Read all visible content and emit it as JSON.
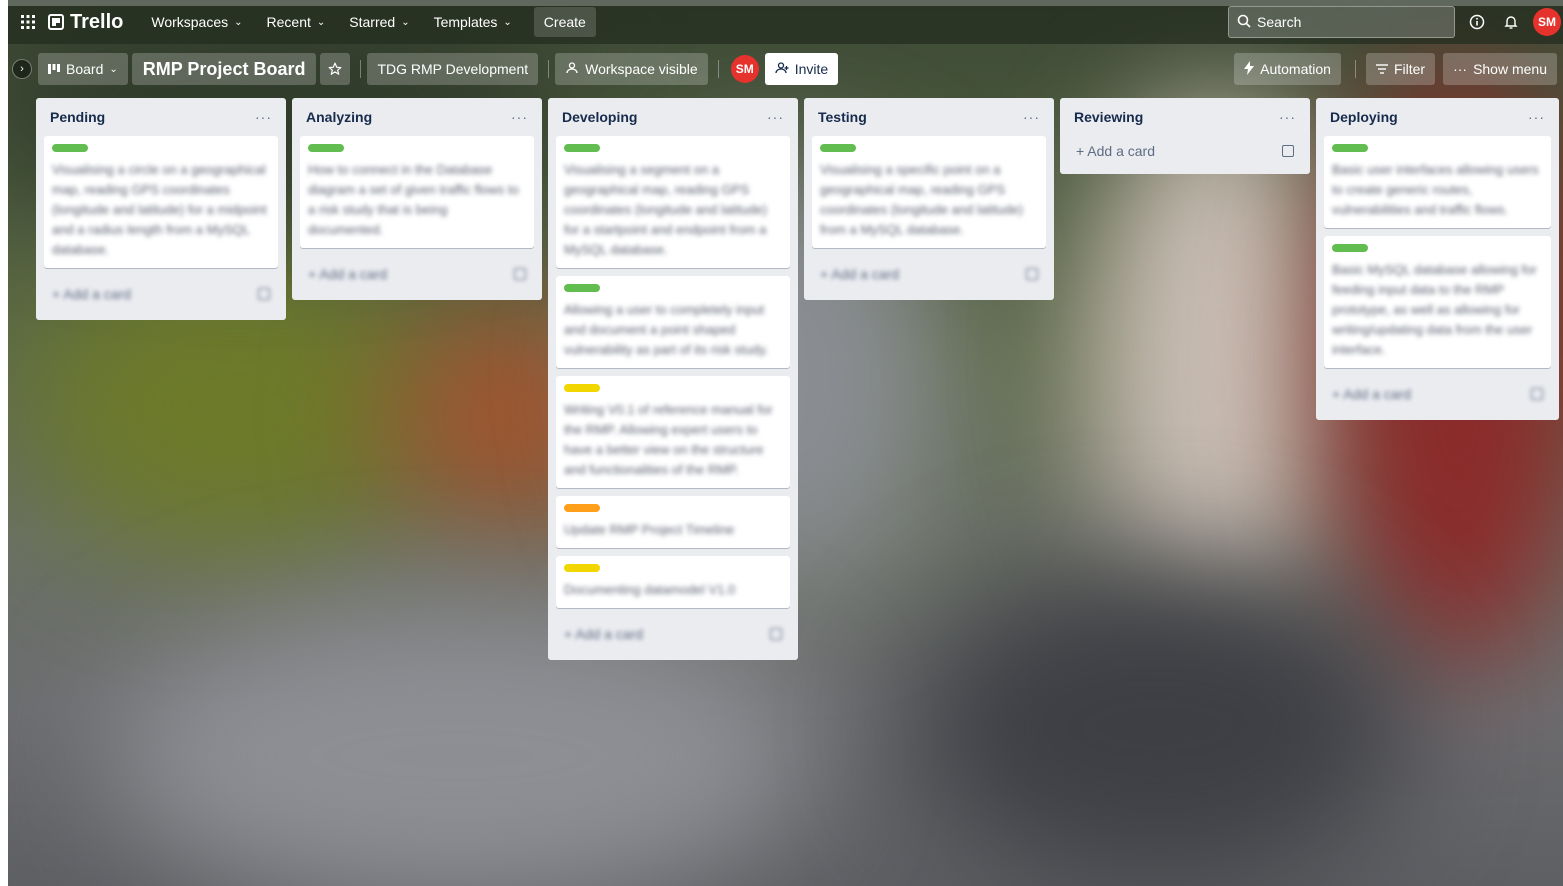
{
  "topbar": {
    "logo": "Trello",
    "nav": [
      {
        "label": "Workspaces"
      },
      {
        "label": "Recent"
      },
      {
        "label": "Starred"
      },
      {
        "label": "Templates"
      }
    ],
    "create": "Create",
    "search_placeholder": "Search",
    "avatar": "SM"
  },
  "boardbar": {
    "view": "Board",
    "title": "RMP Project Board",
    "workspace": "TDG RMP Development",
    "visibility": "Workspace visible",
    "member_avatar": "SM",
    "invite": "Invite",
    "automation": "Automation",
    "filter": "Filter",
    "show_menu": "Show menu"
  },
  "add_card_label": "Add a card",
  "colors": {
    "green": "#61bd4f",
    "yellow": "#f2d600",
    "orange": "#ff9f1a",
    "avatar_red": "#e5322d"
  },
  "lists": [
    {
      "title": "Pending",
      "cards": [
        {
          "label": "green",
          "text": "Visualising a circle on a geographical map, reading GPS coordinates (longitude and latitude) for a midpoint and a radius length from a MySQL database."
        }
      ]
    },
    {
      "title": "Analyzing",
      "cards": [
        {
          "label": "green",
          "text": "How to connect in the Database diagram a set of given traffic flows to a risk study that is being documented."
        }
      ]
    },
    {
      "title": "Developing",
      "cards": [
        {
          "label": "green",
          "text": "Visualising a segment on a geographical map, reading GPS coordinates (longitude and latitude) for a startpoint and endpoint from a MySQL database."
        },
        {
          "label": "green",
          "text": "Allowing a user to completely input and document a point shaped vulnerability as part of its risk study."
        },
        {
          "label": "yellow",
          "text": "Writing V0.1 of reference manual for the RMP. Allowing expert users to have a better view on the structure and functionalities of the RMP."
        },
        {
          "label": "orange",
          "text": "Update RMP Project Timeline"
        },
        {
          "label": "yellow",
          "text": "Documenting datamodel V1.0"
        }
      ]
    },
    {
      "title": "Testing",
      "cards": [
        {
          "label": "green",
          "text": "Visualising a specific point on a geographical map, reading GPS coordinates (longitude and latitude) from a MySQL database."
        }
      ]
    },
    {
      "title": "Reviewing",
      "cards": []
    },
    {
      "title": "Deploying",
      "cards": [
        {
          "label": "green",
          "text": "Basic user interfaces allowing users to create generic routes, vulnerabilities and traffic flows."
        },
        {
          "label": "green",
          "text": "Basic MySQL database allowing for feeding input data to the RMP prototype, as well as allowing for writing/updating data from the user interface."
        }
      ]
    }
  ]
}
